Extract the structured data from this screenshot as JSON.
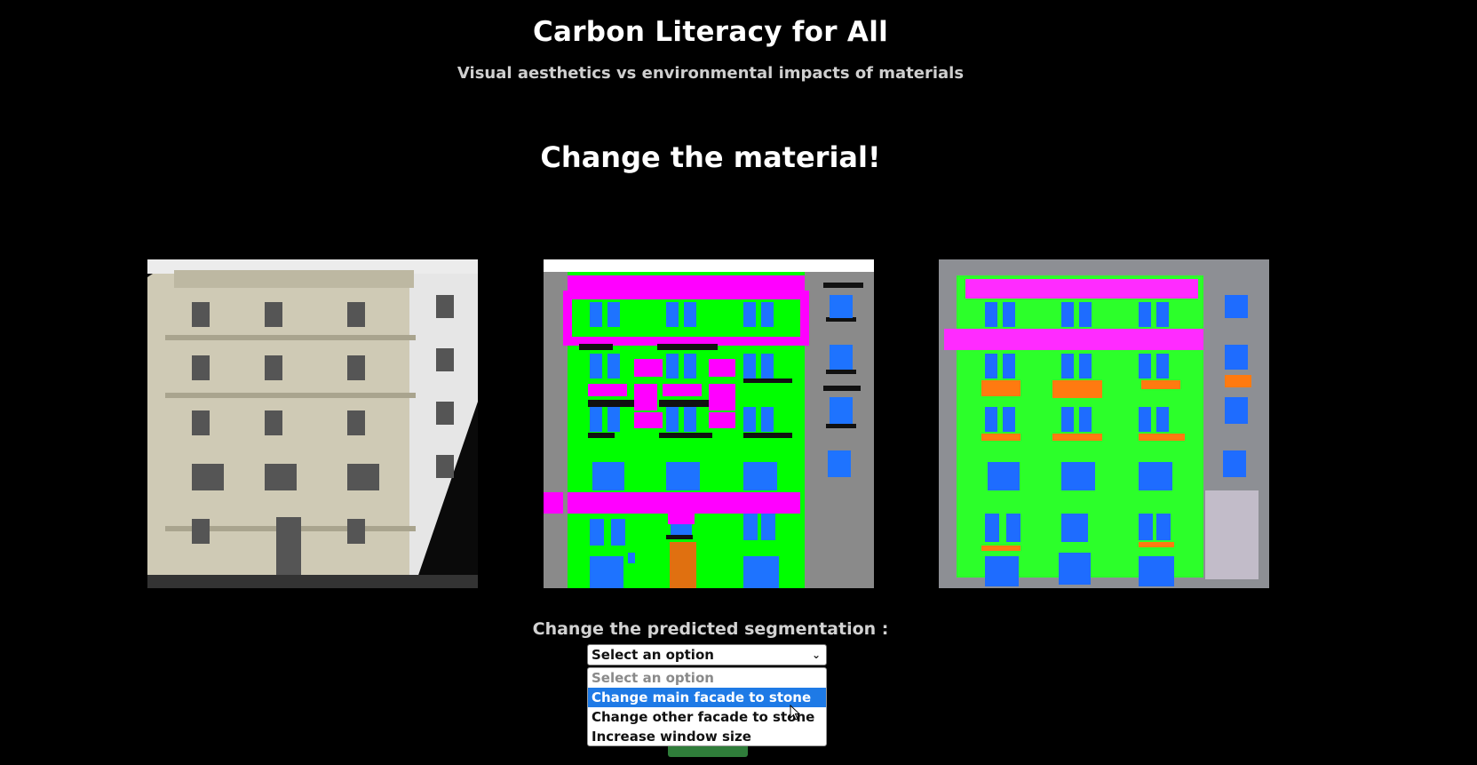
{
  "header": {
    "title": "Carbon Literacy for All",
    "subtitle": "Visual aesthetics vs environmental impacts of materials"
  },
  "main": {
    "heading": "Change the material!",
    "images": [
      {
        "name": "original-facade-photo"
      },
      {
        "name": "segmentation-map"
      },
      {
        "name": "generated-facade"
      }
    ],
    "segmentation": {
      "label": "Change the predicted segmentation :",
      "selected": "Select an option",
      "options": [
        "Select an option",
        "Change main facade to stone",
        "Change other facade to stone",
        "Increase window size"
      ],
      "highlighted_index": 1
    }
  },
  "colors": {
    "background": "#000000",
    "facade": "#00ff00",
    "window": "#1e73ff",
    "molding": "#ff00ff",
    "door": "#e07010",
    "wall": "#8a8a8a",
    "highlight": "#1e7ae6"
  },
  "icons": {
    "dropdown": "chevron-down-icon"
  }
}
